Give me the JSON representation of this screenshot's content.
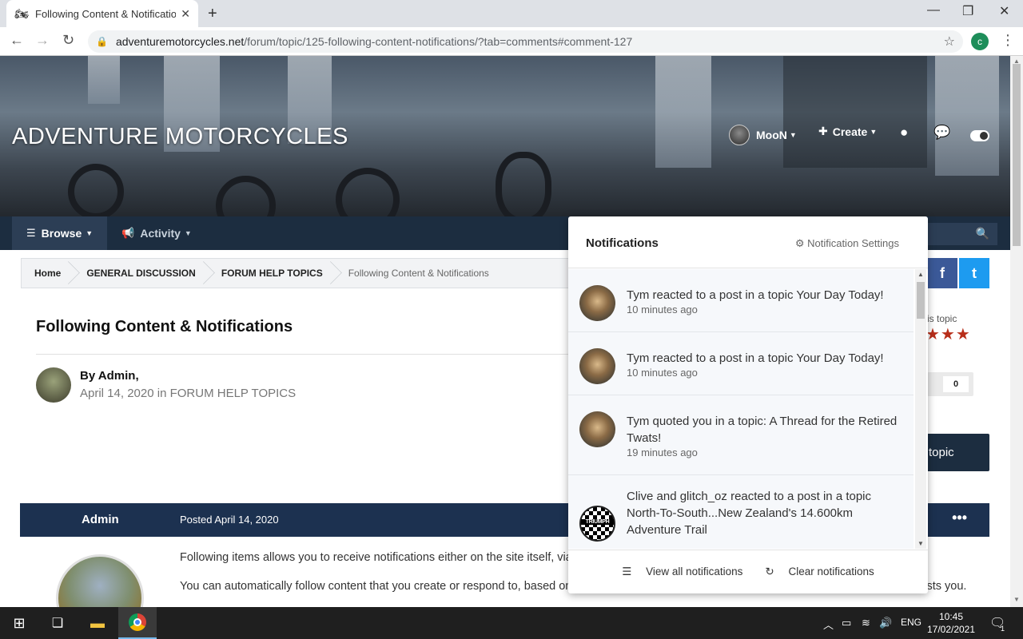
{
  "browser": {
    "tab_title": "Following Content & Notifications",
    "tab_close": "✕",
    "new_tab": "+",
    "win_minimize": "—",
    "win_restore": "❐",
    "win_close": "✕",
    "url_host": "adventuremotorcycles.net",
    "url_path": "/forum/topic/125-following-content-notifications/?tab=comments#comment-127",
    "profile_initial": "c",
    "back": "←",
    "forward": "→",
    "reload": "↻",
    "bookmark": "☆",
    "menu": "⋮"
  },
  "site": {
    "title": "ADVENTURE MOTORCYCLES",
    "user_name": "MooN",
    "create_label": "Create",
    "nav": [
      {
        "label": "Browse",
        "icon": "☰"
      },
      {
        "label": "Activity",
        "icon": "📢"
      }
    ]
  },
  "breadcrumb": [
    "Home",
    "GENERAL DISCUSSION",
    "FORUM HELP TOPICS",
    "Following Content & Notifications"
  ],
  "share": {
    "facebook": "f",
    "twitter": "t"
  },
  "topic": {
    "title": "Following Content & Notifications",
    "by": "By Admin,",
    "date": "April 14, 2020 in ",
    "category": "FORUM HELP TOPICS",
    "rating_label": "is topic",
    "stars": "★★★",
    "rep_count": "0",
    "reply_label": "topic"
  },
  "post": {
    "author": "Admin",
    "posted": "Posted April 14, 2020",
    "more": "•••",
    "paragraphs": [
      "Following items allows you to receive notifications either on the site itself, via email, or push on the mobile app.",
      "You can automatically follow content that you create or respond to, based on your own user preferences, or choose to follow something that interests you."
    ]
  },
  "notifications": {
    "title": "Notifications",
    "settings_label": "Notification Settings",
    "items": [
      {
        "message": "Tym reacted to a post in a topic Your Day Today!",
        "time": "10 minutes ago"
      },
      {
        "message": "Tym reacted to a post in a topic Your Day Today!",
        "time": "10 minutes ago"
      },
      {
        "message": "Tym quoted you in a topic: A Thread for the Retired Twats!",
        "time": "19 minutes ago"
      },
      {
        "message": "Clive and glitch_oz reacted to a post in a topic North-To-South...New Zealand's 14.600km Adventure Trail",
        "time": ""
      }
    ],
    "badge_text": "TRIUMPH",
    "view_all": "View all notifications",
    "clear": "Clear notifications"
  },
  "taskbar": {
    "lang": "ENG",
    "time": "10:45",
    "date": "17/02/2021",
    "notif_count": "1"
  },
  "colors": {
    "nav_bg": "#1c2d40",
    "post_bar": "#1c3150",
    "star": "#b82e1a",
    "facebook": "#3b5998",
    "twitter": "#1d9bf0"
  }
}
